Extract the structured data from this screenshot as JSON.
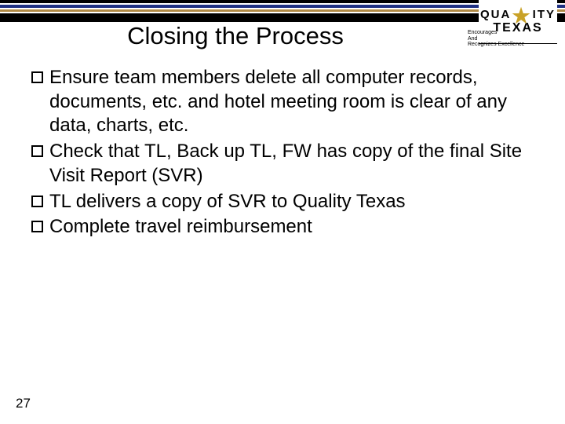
{
  "bars": {},
  "logo": {
    "row1_left": "QUA",
    "row1_right": "ITY",
    "row2": "TEXAS",
    "star_symbol": "★"
  },
  "tagline": {
    "line1": "Encourages",
    "line2": "And",
    "line3": "Recognizes Excellence"
  },
  "title": "Closing the Process",
  "bullets": [
    "Ensure team members delete all computer records, documents, etc. and hotel meeting room is clear of any data, charts, etc.",
    "Check that TL, Back up TL, FW has copy of the final Site Visit Report (SVR)",
    "TL delivers a copy of SVR to Quality Texas",
    "Complete travel reimbursement"
  ],
  "page_number": "27"
}
